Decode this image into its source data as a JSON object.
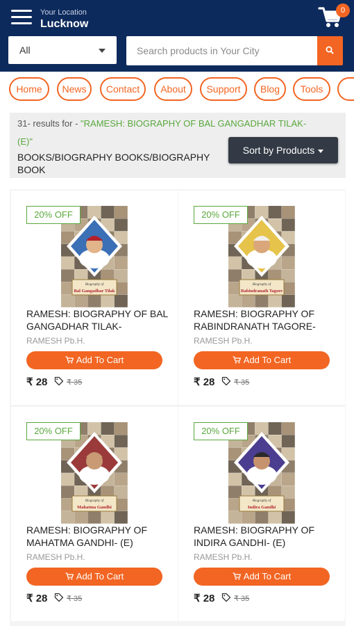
{
  "header": {
    "location_caption": "Your Location",
    "city": "Lucknow",
    "cart_count": "0",
    "category_selected": "All",
    "search_placeholder": "Search products in Your City"
  },
  "nav": {
    "items": [
      "Home",
      "News",
      "Contact",
      "About",
      "Support",
      "Blog",
      "Tools"
    ]
  },
  "results": {
    "count_text": "31- results for - ",
    "query_part1": "\"RAMESH: BIOGRAPHY OF BAL GANGADHAR TILAK-",
    "query_part2": "(E)\"",
    "category_path": "BOOKS/BIOGRAPHY BOOKS/BIOGRAPHY BOOK",
    "sort_label": "Sort by Products"
  },
  "colors": {
    "header_bg": "#0d2a5c",
    "accent": "#f26522",
    "discount_green": "#5aa83e",
    "sort_button": "#333a45"
  },
  "products": [
    {
      "discount": "20% OFF",
      "title": "RAMESH: BIOGRAPHY OF BAL GANGADHAR TILAK-",
      "publisher": "RAMESH Pb.H.",
      "add_to_cart": "Add To Cart",
      "price": "₹ 28",
      "mrp": "₹ 35",
      "cover_caption_top": "Biography of",
      "cover_caption_name": "Bal Gangadhar Tilak",
      "cover_theme": "blue"
    },
    {
      "discount": "20% OFF",
      "title": "RAMESH: BIOGRAPHY OF RABINDRANATH TAGORE-",
      "publisher": "RAMESH Pb.H.",
      "add_to_cart": "Add To Cart",
      "price": "₹ 28",
      "mrp": "₹ 35",
      "cover_caption_top": "Biography of",
      "cover_caption_name": "Rabindranath Tagore",
      "cover_theme": "yellow"
    },
    {
      "discount": "20% OFF",
      "title": "RAMESH: BIOGRAPHY OF MAHATMA GANDHI- (E)",
      "publisher": "RAMESH Pb.H.",
      "add_to_cart": "Add To Cart",
      "price": "₹ 28",
      "mrp": "₹ 35",
      "cover_caption_top": "Biography of",
      "cover_caption_name": "Mahatma Gandhi",
      "cover_theme": "red"
    },
    {
      "discount": "20% OFF",
      "title": "RAMESH: BIOGRAPHY OF INDIRA GANDHI- (E)",
      "publisher": "RAMESH Pb.H.",
      "add_to_cart": "Add To Cart",
      "price": "₹ 28",
      "mrp": "₹ 35",
      "cover_caption_top": "Biography of",
      "cover_caption_name": "Indira Gandhi",
      "cover_theme": "purple"
    }
  ]
}
